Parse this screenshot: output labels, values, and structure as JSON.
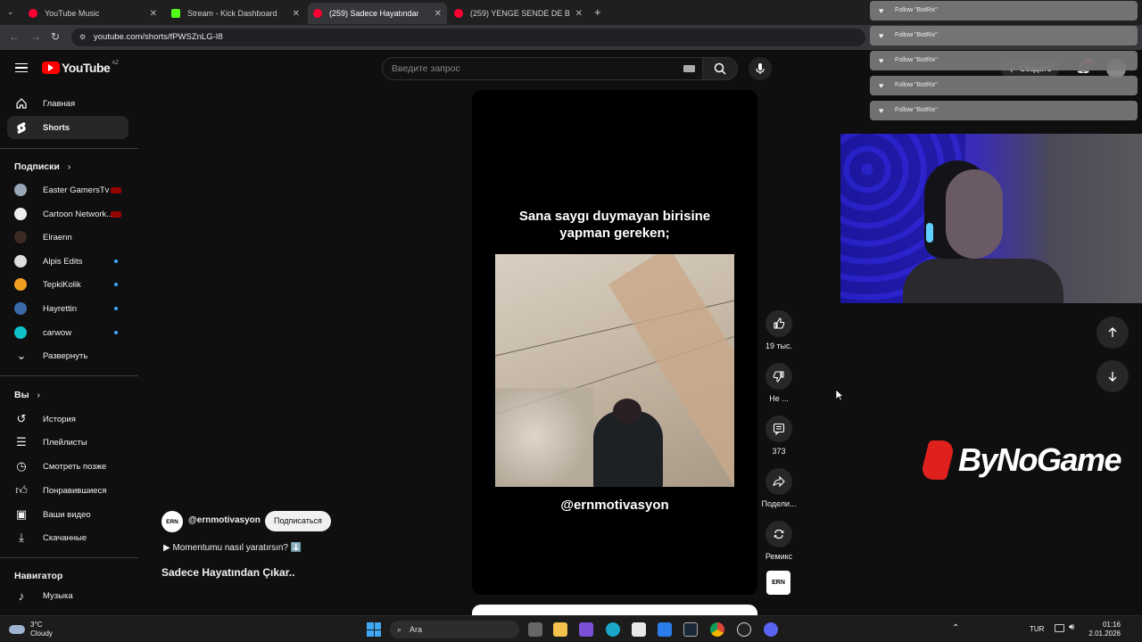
{
  "browser": {
    "tabs": [
      {
        "title": "YouTube Music",
        "color": "#ff0033"
      },
      {
        "title": "Stream - Kick Dashboard",
        "color": "#53fc18"
      },
      {
        "title": "(259) Sadece Hayatından Ç",
        "color": "#ff0033"
      },
      {
        "title": "(259) YENGE SENDE DE BİR 8",
        "color": "#ff0033"
      }
    ],
    "url": "youtube.com/shorts/fPWSZnLG-I8"
  },
  "youtube": {
    "logo_text": "YouTube",
    "region": "AZ",
    "search_placeholder": "Введите запрос",
    "create_label": "Создать",
    "notif_count": "9+",
    "nav": [
      {
        "label": "Главная",
        "icon": "home-icon"
      },
      {
        "label": "Shorts",
        "icon": "shorts-icon"
      }
    ],
    "subs_heading": "Подписки",
    "subscriptions": [
      {
        "name": "Easter GamersTv",
        "color": "#9aa7b8",
        "badge": "live"
      },
      {
        "name": "Cartoon Network...",
        "color": "#eeeeee",
        "badge": "live"
      },
      {
        "name": "Elraenn",
        "color": "#3a2a22",
        "badge": ""
      },
      {
        "name": "Alpis Edits",
        "color": "#dddddd",
        "badge": "dot"
      },
      {
        "name": "TepkiKolik",
        "color": "#f0a020",
        "badge": "dot"
      },
      {
        "name": "Hayrettin",
        "color": "#3c6aa8",
        "badge": "dot"
      },
      {
        "name": "carwow",
        "color": "#10c0c8",
        "badge": "dot"
      }
    ],
    "expand_label": "Развернуть",
    "you_heading": "Вы",
    "you_items": [
      {
        "label": "История",
        "icon": "history-icon"
      },
      {
        "label": "Плейлисты",
        "icon": "playlist-icon"
      },
      {
        "label": "Смотреть позже",
        "icon": "watch-later-icon"
      },
      {
        "label": "Понравившиеся",
        "icon": "like-icon"
      },
      {
        "label": "Ваши видео",
        "icon": "your-videos-icon"
      },
      {
        "label": "Скачанные",
        "icon": "download-icon"
      }
    ],
    "navigator_heading": "Навигатор",
    "navigator_items": [
      {
        "label": "Музыка",
        "icon": "music-icon"
      }
    ],
    "short": {
      "caption_line1": "Sana saygı duymayan birisine",
      "caption_line2": "yapman gereken;",
      "handle_overlay": "@ernmotivasyon",
      "channel_avatar": "ERN",
      "channel_handle": "@ernmotivasyon",
      "subscribe_label": "Подписаться",
      "description": "▶ Momentumu nasıl yaratırsın? ⬇️",
      "title": "Sadece Hayatından Çıkar.."
    },
    "actions": {
      "likes": "19 тыс.",
      "dislike": "Не ...",
      "comments": "373",
      "share": "Подели...",
      "remix": "Ремикс",
      "sound_thumb": "ERN"
    }
  },
  "overlay": {
    "notifications": [
      "Follow \"BotRix\"",
      "Follow \"BotRix\"",
      "Follow \"BotRix\"",
      "Follow \"BotRix\"",
      "Follow \"BotRix\""
    ],
    "brand": "ByNoGame"
  },
  "taskbar": {
    "temp": "3°C",
    "weather": "Cloudy",
    "search_label": "Ara",
    "lang": "TUR",
    "time": "01:16",
    "date": "2.01.2026"
  }
}
